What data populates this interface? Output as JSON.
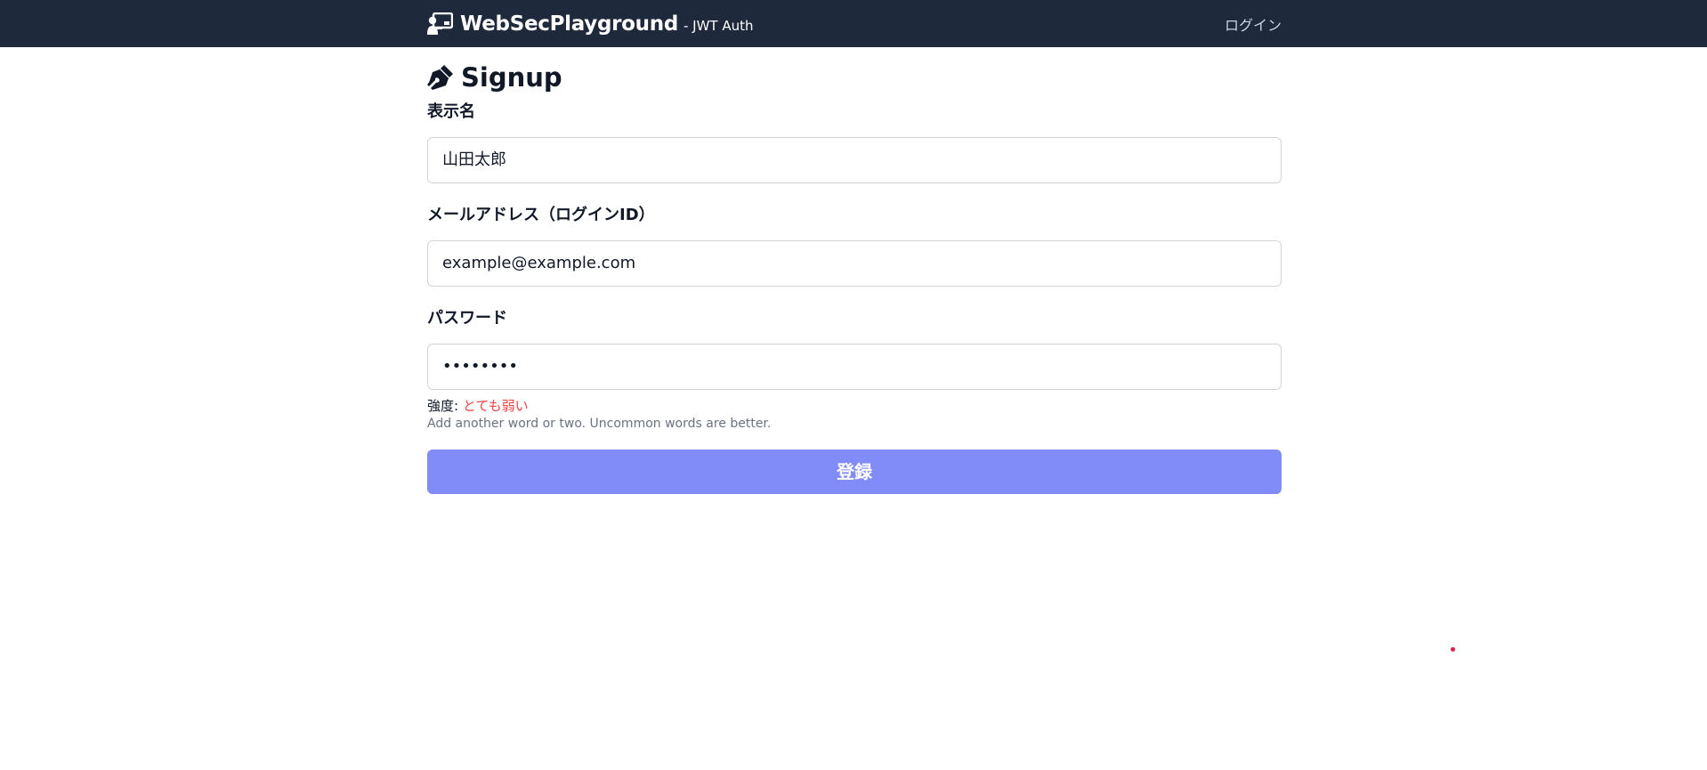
{
  "navbar": {
    "brand_name": "WebSecPlayground",
    "brand_sub": "- JWT Auth",
    "brand_icon": "presentation-user-icon",
    "login_link": "ログイン",
    "background": "#1e293b"
  },
  "page": {
    "title": "Signup",
    "title_icon": "pen-nib-icon"
  },
  "form": {
    "display_name": {
      "label": "表示名",
      "value": "山田太郎"
    },
    "email": {
      "label": "メールアドレス（ログインID）",
      "value": "example@example.com"
    },
    "password": {
      "label": "パスワード",
      "value": "••••••••"
    },
    "strength_label": "強度:",
    "strength_value": "とても弱い",
    "strength_color": "#ef4444",
    "hint": "Add another word or two. Uncommon words are better.",
    "submit_label": "登録",
    "submit_color": "#818cf8"
  }
}
